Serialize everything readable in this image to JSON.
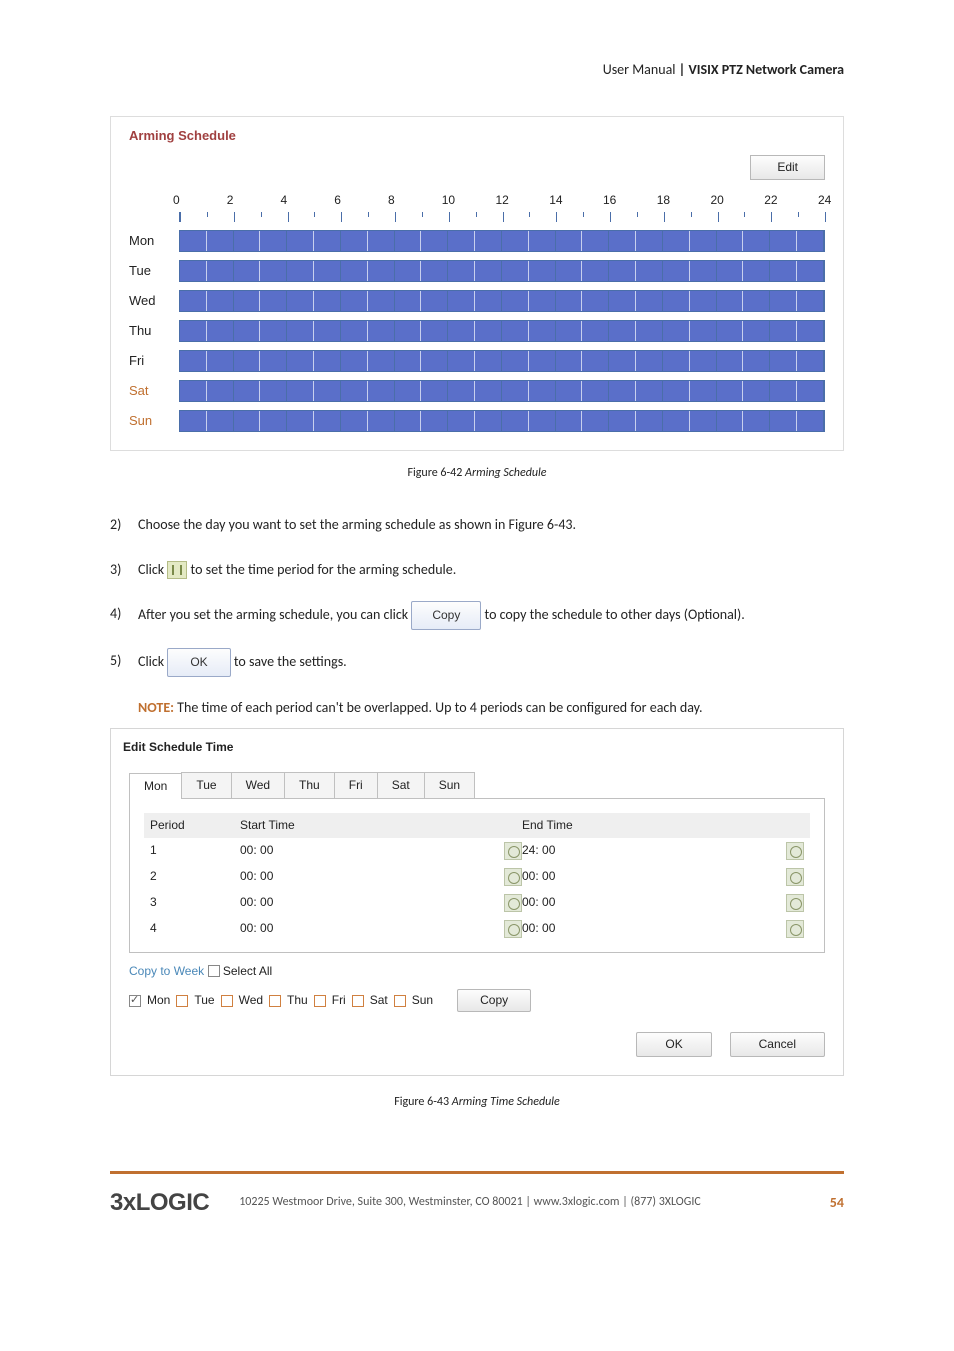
{
  "header": {
    "prefix": "User Manual ",
    "bold": "| VISIX PTZ Network Camera"
  },
  "arming": {
    "title": "Arming Schedule",
    "edit_label": "Edit",
    "hours": [
      "0",
      "2",
      "4",
      "6",
      "8",
      "10",
      "12",
      "14",
      "16",
      "18",
      "20",
      "22",
      "24"
    ],
    "days": [
      {
        "label": "Mon",
        "weekend": false
      },
      {
        "label": "Tue",
        "weekend": false
      },
      {
        "label": "Wed",
        "weekend": false
      },
      {
        "label": "Thu",
        "weekend": false
      },
      {
        "label": "Fri",
        "weekend": false
      },
      {
        "label": "Sat",
        "weekend": true
      },
      {
        "label": "Sun",
        "weekend": true
      }
    ]
  },
  "fig42": {
    "label": "Figure 6-42 ",
    "title": "Arming Schedule"
  },
  "steps": {
    "s2_num": "2)",
    "s2_text": "Choose the day you want to set the arming schedule as shown in Figure 6-43.",
    "s3_num": "3)",
    "s3_pre": "Click ",
    "s3_post": " to set the time period for the arming schedule.",
    "s4_num": "4)",
    "s4_pre": "After you set the arming schedule, you can click ",
    "s4_btn": "Copy",
    "s4_post": "to copy the schedule to other days (Optional).",
    "s5_num": "5)",
    "s5_pre": "Click ",
    "s5_btn": "OK",
    "s5_post": " to save the settings."
  },
  "note": {
    "label": "NOTE: ",
    "text": "The time of each period can't be overlapped. Up to 4 periods can be configured for each day."
  },
  "est": {
    "title": "Edit Schedule Time",
    "tabs": [
      "Mon",
      "Tue",
      "Wed",
      "Thu",
      "Fri",
      "Sat",
      "Sun"
    ],
    "head_period": "Period",
    "head_start": "Start Time",
    "head_end": "End Time",
    "rows": [
      {
        "period": "1",
        "start": "00: 00",
        "end": "24: 00"
      },
      {
        "period": "2",
        "start": "00: 00",
        "end": "00: 00"
      },
      {
        "period": "3",
        "start": "00: 00",
        "end": "00: 00"
      },
      {
        "period": "4",
        "start": "00: 00",
        "end": "00: 00"
      }
    ],
    "copy_to_week": "Copy to Week",
    "select_all": "Select All",
    "day_checks": [
      "Mon",
      "Tue",
      "Wed",
      "Thu",
      "Fri",
      "Sat",
      "Sun"
    ],
    "copy_label": "Copy",
    "ok_label": "OK",
    "cancel_label": "Cancel"
  },
  "fig43": {
    "label": "Figure 6-43 ",
    "title": "Arming Time Schedule"
  },
  "footer": {
    "logo": "3xLOGIC",
    "text": "10225 Westmoor Drive, Suite 300, Westminster, CO 80021 | www.3xlogic.com | (877) 3XLOGIC",
    "page": "54"
  }
}
